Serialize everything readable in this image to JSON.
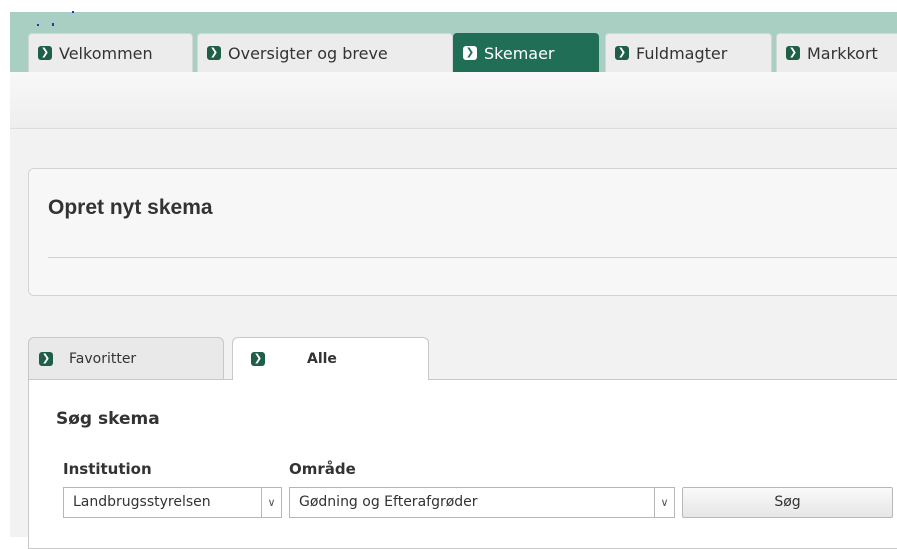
{
  "top_tabs": [
    {
      "label": "Velkommen"
    },
    {
      "label": "Oversigter og breve"
    },
    {
      "label": "Skemaer"
    },
    {
      "label": "Fuldmagter"
    },
    {
      "label": "Markkort"
    }
  ],
  "active_top_tab": "Skemaer",
  "panel": {
    "title": "Opret nyt skema"
  },
  "sub_tabs": [
    {
      "label": "Favoritter"
    },
    {
      "label": "Alle"
    }
  ],
  "active_sub_tab": "Alle",
  "search": {
    "heading": "Søg skema",
    "institution_label": "Institution",
    "institution_value": "Landbrugsstyrelsen",
    "area_label": "Område",
    "area_value": "Gødning og Efterafgrøder",
    "button_label": "Søg"
  },
  "icons": {
    "tab_icon": "chevron-right-icon",
    "dropdown_icon": "chevron-down-icon"
  },
  "colors": {
    "accent": "#1f6e55",
    "header_band": "#a9cfc3",
    "content_bg": "#f2f2f2"
  }
}
